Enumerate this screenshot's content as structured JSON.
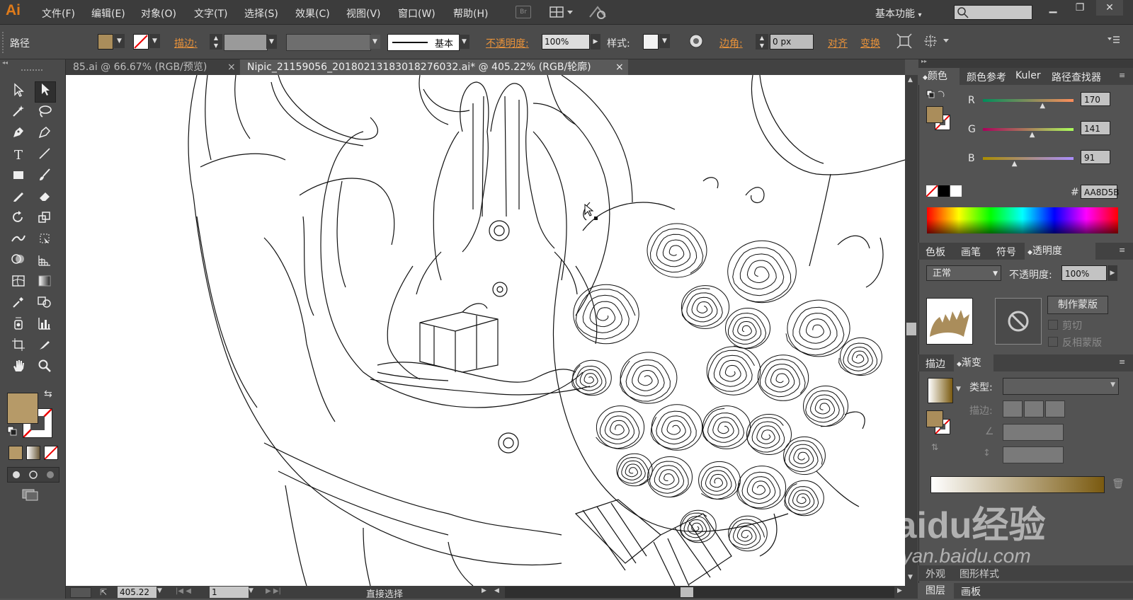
{
  "app": {
    "logo": "Ai"
  },
  "menu": [
    "文件(F)",
    "编辑(E)",
    "对象(O)",
    "文字(T)",
    "选择(S)",
    "效果(C)",
    "视图(V)",
    "窗口(W)",
    "帮助(H)"
  ],
  "bridge_label": "Br",
  "workspace": "基本功能",
  "control_bar": {
    "selection_label": "路径",
    "fill_color": "#AA8D5B",
    "stroke_label": "描边:",
    "stroke_style": "基本",
    "opacity_label": "不透明度:",
    "opacity_value": "100%",
    "style_label": "样式:",
    "corner_label": "边角:",
    "corner_value": "0 px",
    "align_label": "对齐",
    "transform_label": "变换"
  },
  "doc_tabs": [
    {
      "title": "85.ai @ 66.67% (RGB/预览)",
      "active": false,
      "close": "×"
    },
    {
      "title": "Nipic_21159056_20180213183018276032.ai* @ 405.22% (RGB/轮廓)",
      "active": true,
      "close": "×"
    }
  ],
  "status_bar": {
    "zoom": "405.22",
    "artboard": "1",
    "tool": "直接选择"
  },
  "color_panel": {
    "tabs": [
      "颜色",
      "颜色参考",
      "Kuler",
      "路径查找器"
    ],
    "r_label": "R",
    "g_label": "G",
    "b_label": "B",
    "r": "170",
    "g": "141",
    "b": "91",
    "r_fraction": 0.667,
    "g_fraction": 0.553,
    "b_fraction": 0.357,
    "hex_label": "#",
    "hex": "AA8D5B"
  },
  "transparency_panel": {
    "tabs": [
      "色板",
      "画笔",
      "符号",
      "透明度"
    ],
    "blend_mode": "正常",
    "opacity_label": "不透明度:",
    "opacity_value": "100%",
    "make_mask": "制作蒙版",
    "clip": "剪切",
    "invert": "反相蒙版"
  },
  "gradient_panel": {
    "tabs": [
      "描边",
      "渐变"
    ],
    "type_label": "类型:",
    "stroke_label": "描边:",
    "start_color": "#ffffff",
    "end_color": "#7a5a10"
  },
  "bottom_panels": {
    "row1": [
      "外观",
      "图形样式"
    ],
    "row2": [
      "图层",
      "画板"
    ]
  },
  "watermark": {
    "text": "Baidu经验",
    "sub": "jingyan.baidu.com"
  },
  "tool_swatches": {
    "fill": "#b69a68",
    "stroke": "none"
  }
}
